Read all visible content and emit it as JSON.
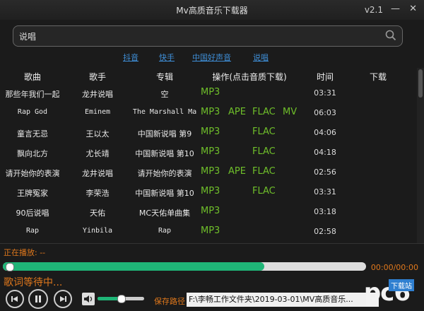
{
  "window": {
    "title": "Mv高质音乐下载器",
    "version": "v2.1",
    "minimize": "—",
    "close": "✕"
  },
  "search": {
    "value": "说唱"
  },
  "sources": [
    "抖音",
    "快手",
    "中国好声音",
    "说唱"
  ],
  "columns": [
    "歌曲",
    "歌手",
    "专辑",
    "操作(点击音质下载)",
    "时间",
    "下载"
  ],
  "rows": [
    {
      "song": "那些年我们一起",
      "singer": "龙井说唱",
      "album": "空",
      "formats": [
        "MP3"
      ],
      "time": "03:31"
    },
    {
      "song": "Rap God",
      "singer": "Eminem",
      "album": "The Marshall Ma",
      "formats": [
        "MP3",
        "APE",
        "FLAC",
        "MV"
      ],
      "time": "06:03"
    },
    {
      "song": "童言无忌",
      "singer": "王以太",
      "album": "中国新说唱 第9",
      "formats": [
        "MP3",
        "FLAC"
      ],
      "time": "04:06"
    },
    {
      "song": "飘向北方",
      "singer": "尤长靖",
      "album": "中国新说唱 第10",
      "formats": [
        "MP3",
        "FLAC"
      ],
      "time": "04:18"
    },
    {
      "song": "请开始你的表演",
      "singer": "龙井说唱",
      "album": "请开始你的表演",
      "formats": [
        "MP3",
        "APE",
        "FLAC"
      ],
      "time": "02:56"
    },
    {
      "song": "王牌冤家",
      "singer": "李荣浩",
      "album": "中国新说唱 第10",
      "formats": [
        "MP3",
        "FLAC"
      ],
      "time": "03:31"
    },
    {
      "song": "90后说唱",
      "singer": "天佑",
      "album": "MC天佑单曲集",
      "formats": [
        "MP3"
      ],
      "time": "03:18"
    },
    {
      "song": "Rap",
      "singer": "Yinbila",
      "album": "Rap",
      "formats": [
        "MP3"
      ],
      "time": "02:58"
    }
  ],
  "player": {
    "now_playing": "正在播放: --",
    "elapsed_total": "00:00/00:00",
    "progress_fraction": 0.72,
    "lyrics": "歌词等待中...",
    "volume_fraction": 0.5,
    "save_label": "保存路径",
    "save_path": "F:\\李畅工作文件夹\\2019-03-01\\MV高质音乐..."
  },
  "watermark": {
    "logo": "pc6",
    "sub": "下载站"
  },
  "colors": {
    "accent": "#e0781c",
    "format": "#6fbf2a",
    "progress": "#1fb577",
    "link": "#3f8fd8"
  }
}
